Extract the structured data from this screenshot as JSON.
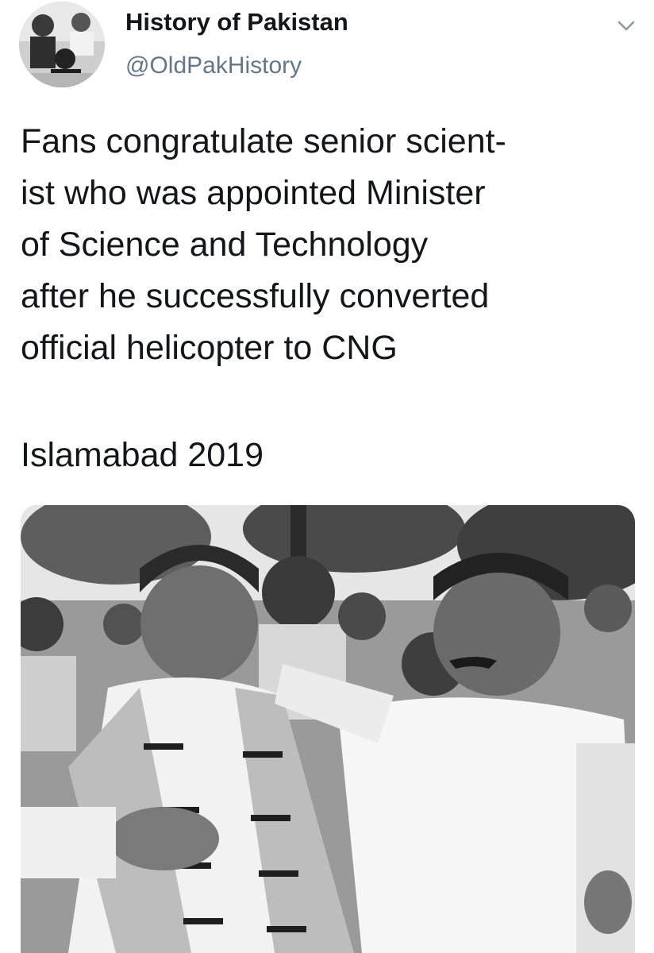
{
  "tweet": {
    "author": {
      "display_name": "History of Pakistan",
      "handle": "@OldPakHistory",
      "avatar_icon": "profile-photo"
    },
    "menu_icon": "chevron-down-icon",
    "text_lines": [
      "Fans congratulate senior scient-",
      "ist who was appointed Minister",
      "of Science and Technology",
      "after he successfully converted",
      "official helicopter to CNG"
    ],
    "location_line": "Islamabad 2019",
    "media": {
      "type": "photo",
      "description_icon": "tweet-photo"
    }
  }
}
